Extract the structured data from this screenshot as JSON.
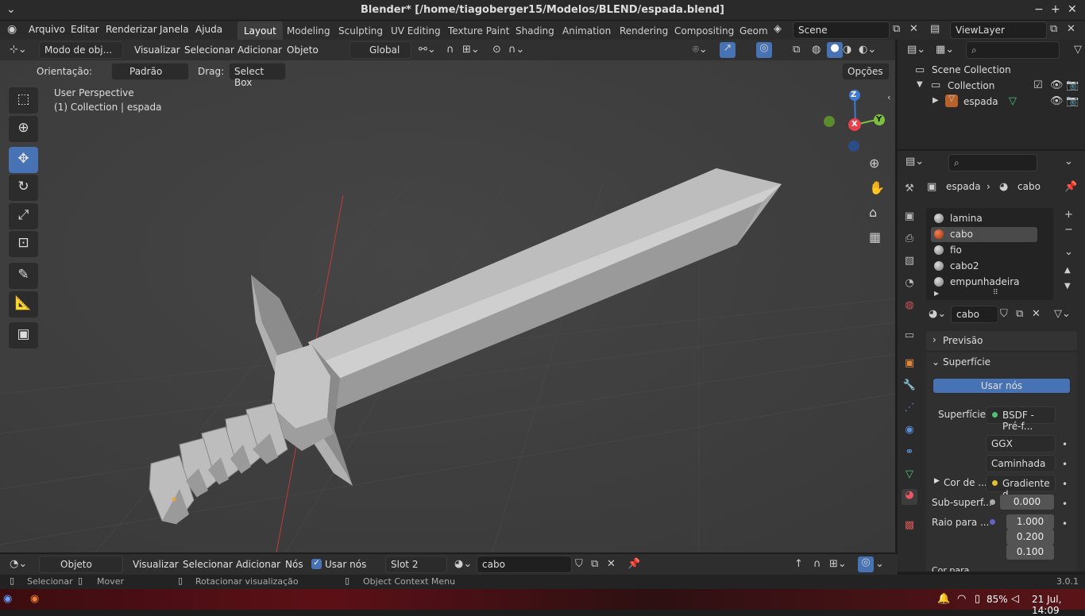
{
  "window": {
    "title": "Blender* [/home/tiagoberger15/Modelos/BLEND/espada.blend]",
    "minimize": "−",
    "maximize": "+",
    "close": "✕",
    "arrow": "⌄"
  },
  "menu": {
    "items": [
      "Arquivo",
      "Editar",
      "Renderizar",
      "Janela",
      "Ajuda"
    ]
  },
  "workspaces": [
    "Layout",
    "Modeling",
    "Sculpting",
    "UV Editing",
    "Texture Paint",
    "Shading",
    "Animation",
    "Rendering",
    "Compositing",
    "Geom"
  ],
  "scene": {
    "name": "Scene",
    "view_layer": "ViewLayer"
  },
  "viewport_header": {
    "mode": "Modo de obj...",
    "menus": [
      "Visualizar",
      "Selecionar",
      "Adicionar",
      "Objeto"
    ],
    "transform_orientation": "Global",
    "orientation_label": "Orientação:",
    "orientation_value": "Padrão",
    "drag_label": "Drag:",
    "drag_value": "Select Box",
    "options": "Opções"
  },
  "viewport": {
    "perspective": "User Perspective",
    "collection_info": "(1) Collection | espada",
    "gizmo": {
      "x": "X",
      "y": "Y",
      "z": "Z"
    }
  },
  "outliner": {
    "scene_collection": "Scene Collection",
    "collection": "Collection",
    "object": "espada"
  },
  "properties": {
    "breadcrumb_object": "espada",
    "breadcrumb_material": "cabo",
    "materials": [
      "lamina",
      "cabo",
      "fio",
      "cabo2",
      "empunhadeira"
    ],
    "selected_material": "cabo",
    "material_name": "cabo",
    "preview_panel": "Previsão",
    "surface_panel": "Superfície",
    "use_nodes": "Usar nós",
    "surface_label": "Superfície",
    "surface_value": "BSDF - Pré-f...",
    "distribution": "GGX",
    "subsurface_method": "Caminhada ...",
    "base_color_label": "Cor de ...",
    "base_color_value": "Gradiente d...",
    "subsurface_label": "Sub-superf...",
    "subsurface_value": "0.000",
    "radius_label": "Raio para ...",
    "radius_values": [
      "1.000",
      "0.200",
      "0.100"
    ],
    "next_label": "Cor para ..."
  },
  "node_header": {
    "mode": "Objeto",
    "menus": [
      "Visualizar",
      "Selecionar",
      "Adicionar",
      "Nós"
    ],
    "use_nodes": "Usar nós",
    "slot": "Slot 2",
    "material": "cabo"
  },
  "statusbar": {
    "select": "Selecionar",
    "move": "Mover",
    "rotate": "Rotacionar visualização",
    "context": "Object Context Menu",
    "version": "3.0.1"
  },
  "taskbar": {
    "battery": "85%",
    "datetime": "21 Jul, 14:09"
  },
  "colors": {
    "accent": "#4772b3",
    "x_axis": "#e8414d",
    "y_axis": "#7fbf3f",
    "z_axis": "#3d7ad6",
    "selected_material": "#c8502a"
  }
}
